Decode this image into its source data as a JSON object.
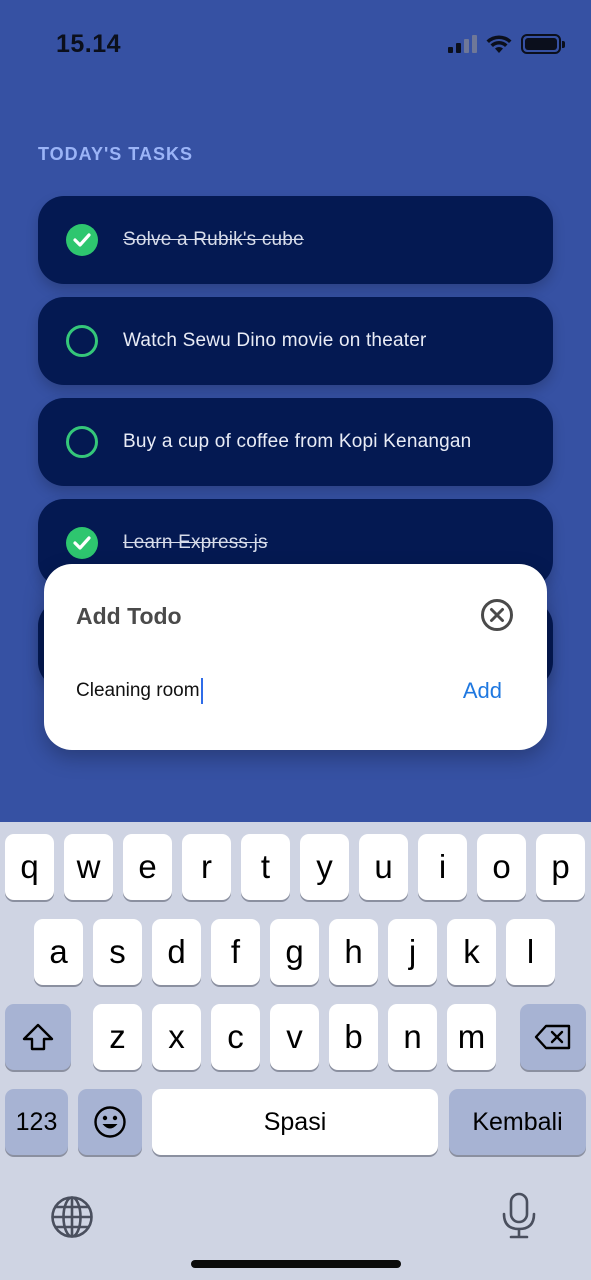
{
  "status_bar": {
    "time": "15.14",
    "signal_icon": "cellular-signal-icon",
    "wifi_icon": "wifi-icon",
    "battery_icon": "battery-icon"
  },
  "section_title": "TODAY'S TASKS",
  "tasks": [
    {
      "label": "Solve a Rubik's cube",
      "done": true
    },
    {
      "label": "Watch Sewu Dino movie on theater",
      "done": false
    },
    {
      "label": "Buy a cup of coffee from Kopi Kenangan",
      "done": false
    },
    {
      "label": "Learn Express.js",
      "done": true
    }
  ],
  "modal": {
    "title": "Add Todo",
    "input_value": "Cleaning room",
    "add_label": "Add",
    "close_icon": "close-circle-icon"
  },
  "keyboard": {
    "row1": [
      "q",
      "w",
      "e",
      "r",
      "t",
      "y",
      "u",
      "i",
      "o",
      "p"
    ],
    "row2": [
      "a",
      "s",
      "d",
      "f",
      "g",
      "h",
      "j",
      "k",
      "l"
    ],
    "row3": [
      "z",
      "x",
      "c",
      "v",
      "b",
      "n",
      "m"
    ],
    "numbers_label": "123",
    "space_label": "Spasi",
    "return_label": "Kembali",
    "shift_icon": "shift-icon",
    "delete_icon": "delete-icon",
    "emoji_icon": "emoji-icon",
    "globe_icon": "globe-icon",
    "mic_icon": "microphone-icon"
  },
  "colors": {
    "background": "#3651a3",
    "task_card": "#041952",
    "check_green": "#2ec66f",
    "accent_blue": "#1f78e0"
  }
}
